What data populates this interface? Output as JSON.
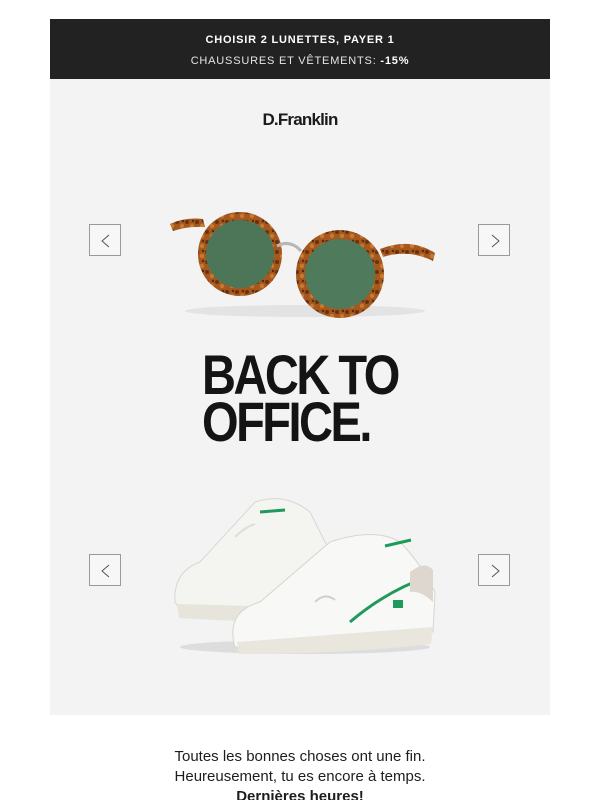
{
  "promo": {
    "line1": "CHOISIR 2 LUNETTES, PAYER 1",
    "line2_text": "CHAUSSURES ET VÊTEMENTS:",
    "line2_discount": "-15%"
  },
  "brand": {
    "logo": "D.Franklin"
  },
  "hero": {
    "headline_line1": "BACK TO",
    "headline_line2": "OFFICE.",
    "prev_icon": "chevron-left-icon",
    "next_icon": "chevron-right-icon",
    "prev_glyph": "<",
    "next_glyph": ">"
  },
  "products": {
    "glasses_image": "tortoise-sunglasses-image",
    "sneakers_image": "white-green-sneakers-image"
  },
  "message": {
    "line1": "Toutes les bonnes choses ont une fin.",
    "line2": "Heureusement, tu es encore à temps.",
    "line3": "Dernières heures!"
  },
  "colors": {
    "banner_bg": "#222222",
    "hero_bg": "#f3f3f3",
    "accent_green": "#1f9a5a"
  }
}
